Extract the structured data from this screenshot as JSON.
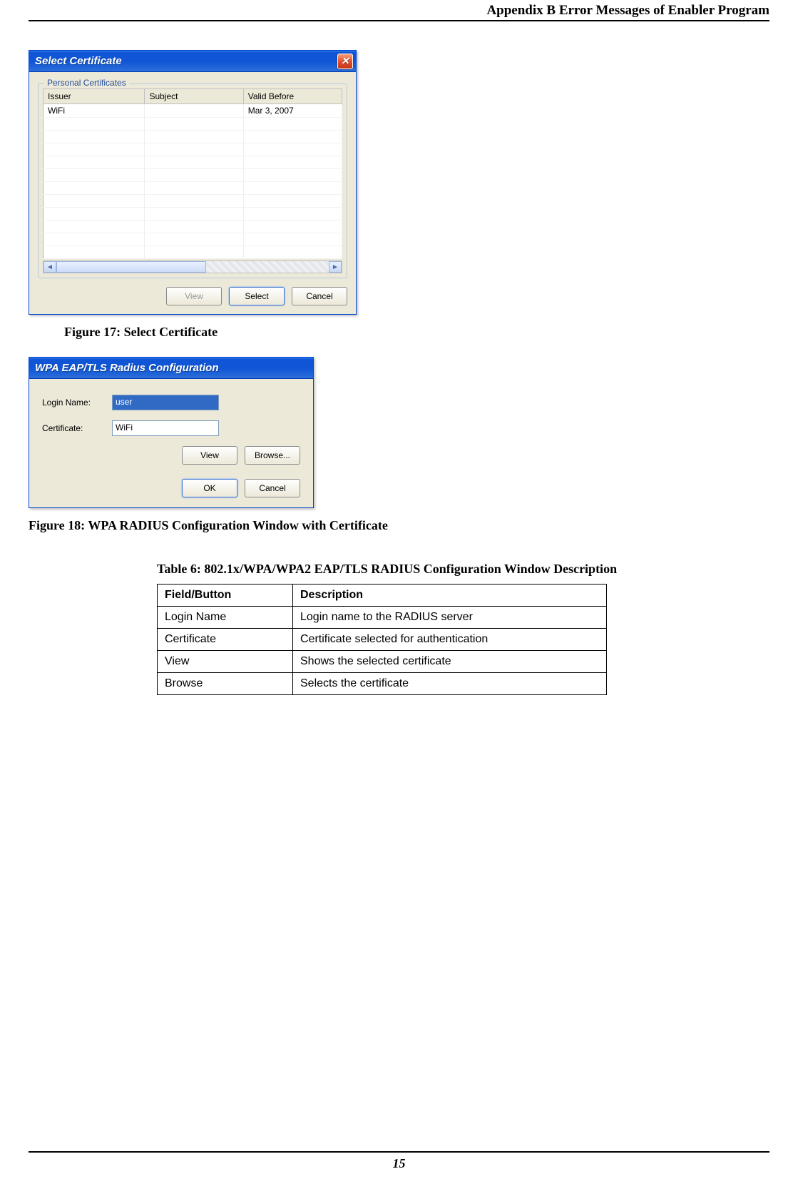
{
  "page": {
    "appendix_header": "Appendix B Error Messages of Enabler Program",
    "number": "15"
  },
  "dialog1": {
    "title": "Select Certificate",
    "group_title": "Personal Certificates",
    "columns": {
      "issuer": "Issuer",
      "subject": "Subject",
      "valid_before": "Valid Before"
    },
    "rows": [
      {
        "issuer": "WiFi",
        "subject": "",
        "valid_before": "Mar 3, 2007"
      }
    ],
    "buttons": {
      "view": "View",
      "select": "Select",
      "cancel": "Cancel"
    }
  },
  "caption1": "Figure 17: Select Certificate",
  "dialog2": {
    "title": "WPA EAP/TLS Radius Configuration",
    "labels": {
      "login": "Login Name:",
      "cert": "Certificate:"
    },
    "values": {
      "login": "user",
      "cert": "WiFi"
    },
    "buttons": {
      "view": "View",
      "browse": "Browse...",
      "ok": "OK",
      "cancel": "Cancel"
    }
  },
  "caption2": "Figure 18: WPA RADIUS Configuration Window with Certificate",
  "table6": {
    "caption": "Table 6: 802.1x/WPA/WPA2 EAP/TLS RADIUS Configuration Window Description",
    "headers": {
      "field": "Field/Button",
      "desc": "Description"
    },
    "rows": [
      {
        "field": "Login Name",
        "desc": "Login name to the RADIUS server"
      },
      {
        "field": "Certificate",
        "desc": "Certificate selected for authentication"
      },
      {
        "field": "View",
        "desc": "Shows the selected certificate"
      },
      {
        "field": "Browse",
        "desc": "Selects the certificate"
      }
    ]
  }
}
